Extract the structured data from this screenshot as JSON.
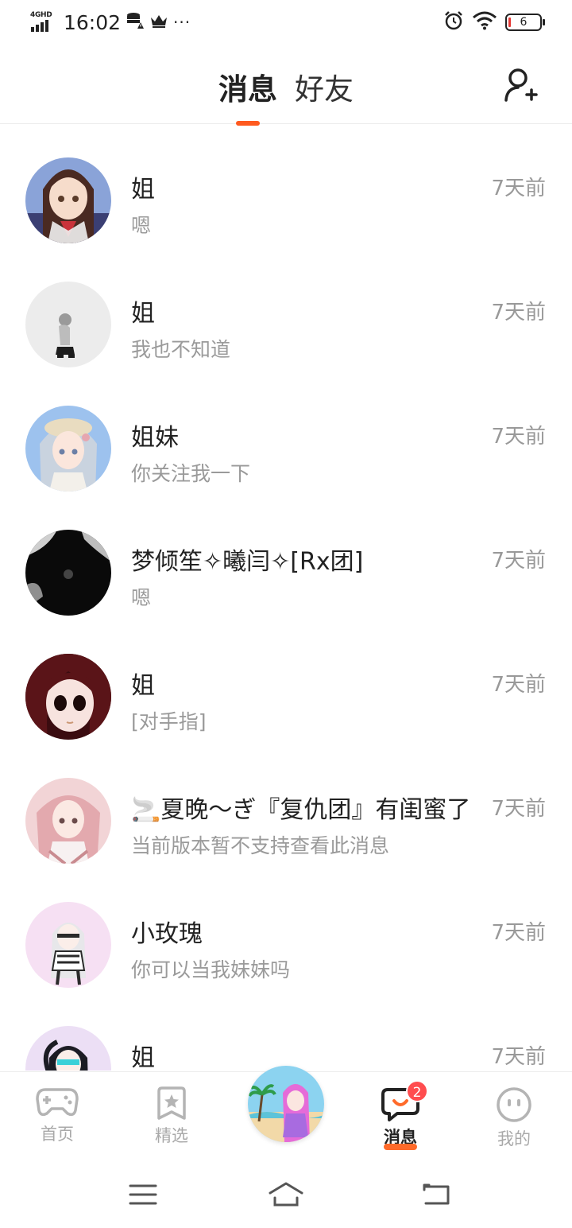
{
  "status_bar": {
    "network": "4GHD",
    "time": "16:02",
    "battery": "6",
    "more": "···"
  },
  "header": {
    "tabs": [
      {
        "label": "消息",
        "active": true
      },
      {
        "label": "好友",
        "active": false
      }
    ],
    "add_friend_icon": "add-user-icon",
    "accent_color": "#ff5a1f"
  },
  "conversations": [
    {
      "name": "姐",
      "message": "嗯",
      "time": "7天前"
    },
    {
      "name": "姐",
      "message": "我也不知道",
      "time": "7天前"
    },
    {
      "name": "姐妹",
      "message": "你关注我一下",
      "time": "7天前"
    },
    {
      "name": "梦倾笙✧曦闫✧[Rx团]",
      "message": "嗯",
      "time": "7天前"
    },
    {
      "name": "姐",
      "message": "[对手指]",
      "time": "7天前"
    },
    {
      "name": "🚬夏晚～ぎ『复仇团』有闺蜜了",
      "message": "当前版本暂不支持查看此消息",
      "time": "7天前"
    },
    {
      "name": "小玫瑰",
      "message": "你可以当我妹妹吗",
      "time": "7天前"
    },
    {
      "name": "姐",
      "message": "",
      "time": "7天前"
    }
  ],
  "bottom_nav": {
    "items": [
      {
        "label": "首页",
        "icon": "gamepad-icon"
      },
      {
        "label": "精选",
        "icon": "star-bookmark-icon"
      },
      {
        "label": "消息",
        "icon": "chat-bubble-icon",
        "badge": "2",
        "active": true
      },
      {
        "label": "我的",
        "icon": "face-icon"
      }
    ]
  },
  "system_nav": {
    "icons": [
      "menu-icon",
      "home-icon",
      "back-icon"
    ]
  }
}
